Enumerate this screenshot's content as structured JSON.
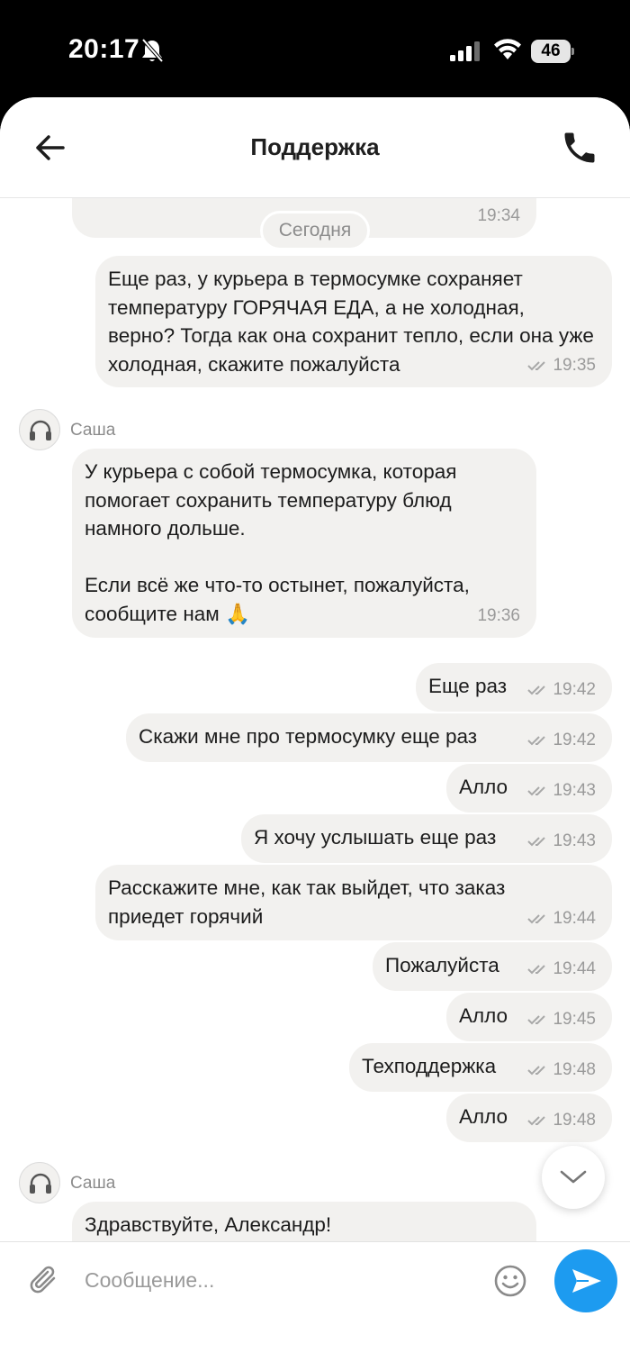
{
  "status_bar": {
    "time": "20:17",
    "battery": "46"
  },
  "header": {
    "title": "Поддержка"
  },
  "date_separator": "Сегодня",
  "messages": [
    {
      "text": "",
      "time": "19:34"
    },
    {
      "text": "Еще раз, у курьера в термосумке сохраняет температуру ГОРЯЧАЯ ЕДА, а не холодная, верно? Тогда как она сохранит тепло, если она уже холодная, скажите пожалуйста",
      "time": "19:35"
    },
    {
      "sender": "Саша",
      "text": "У курьера с собой термосумка, которая помогает сохранить температуру блюд намного дольше.\n\nЕсли всё же что-то остынет, пожалуйста, сообщите нам 🙏",
      "time": "19:36"
    },
    {
      "text": "Еще раз",
      "time": "19:42"
    },
    {
      "text": "Скажи мне про термосумку еще раз",
      "time": "19:42"
    },
    {
      "text": "Алло",
      "time": "19:43"
    },
    {
      "text": "Я хочу услышать еще раз",
      "time": "19:43"
    },
    {
      "text": "Расскажите мне, как так выйдет, что заказ приедет горячий",
      "time": "19:44"
    },
    {
      "text": "Пожалуйста",
      "time": "19:44"
    },
    {
      "text": "Алло",
      "time": "19:45"
    },
    {
      "text": "Техподдержка",
      "time": "19:48"
    },
    {
      "text": "Алло",
      "time": "19:48"
    },
    {
      "sender": "Саша",
      "text": "Здравствуйте, Александр!"
    }
  ],
  "composer": {
    "placeholder": "Сообщение..."
  },
  "colors": {
    "bubble": "#f2f1ef",
    "send_button": "#1d9bf0",
    "meta_text": "#9a9a9a"
  },
  "icons": [
    "back-arrow-icon",
    "phone-icon",
    "double-check-icon",
    "headset-icon",
    "chevron-down-icon",
    "paperclip-icon",
    "smile-icon",
    "send-icon"
  ]
}
